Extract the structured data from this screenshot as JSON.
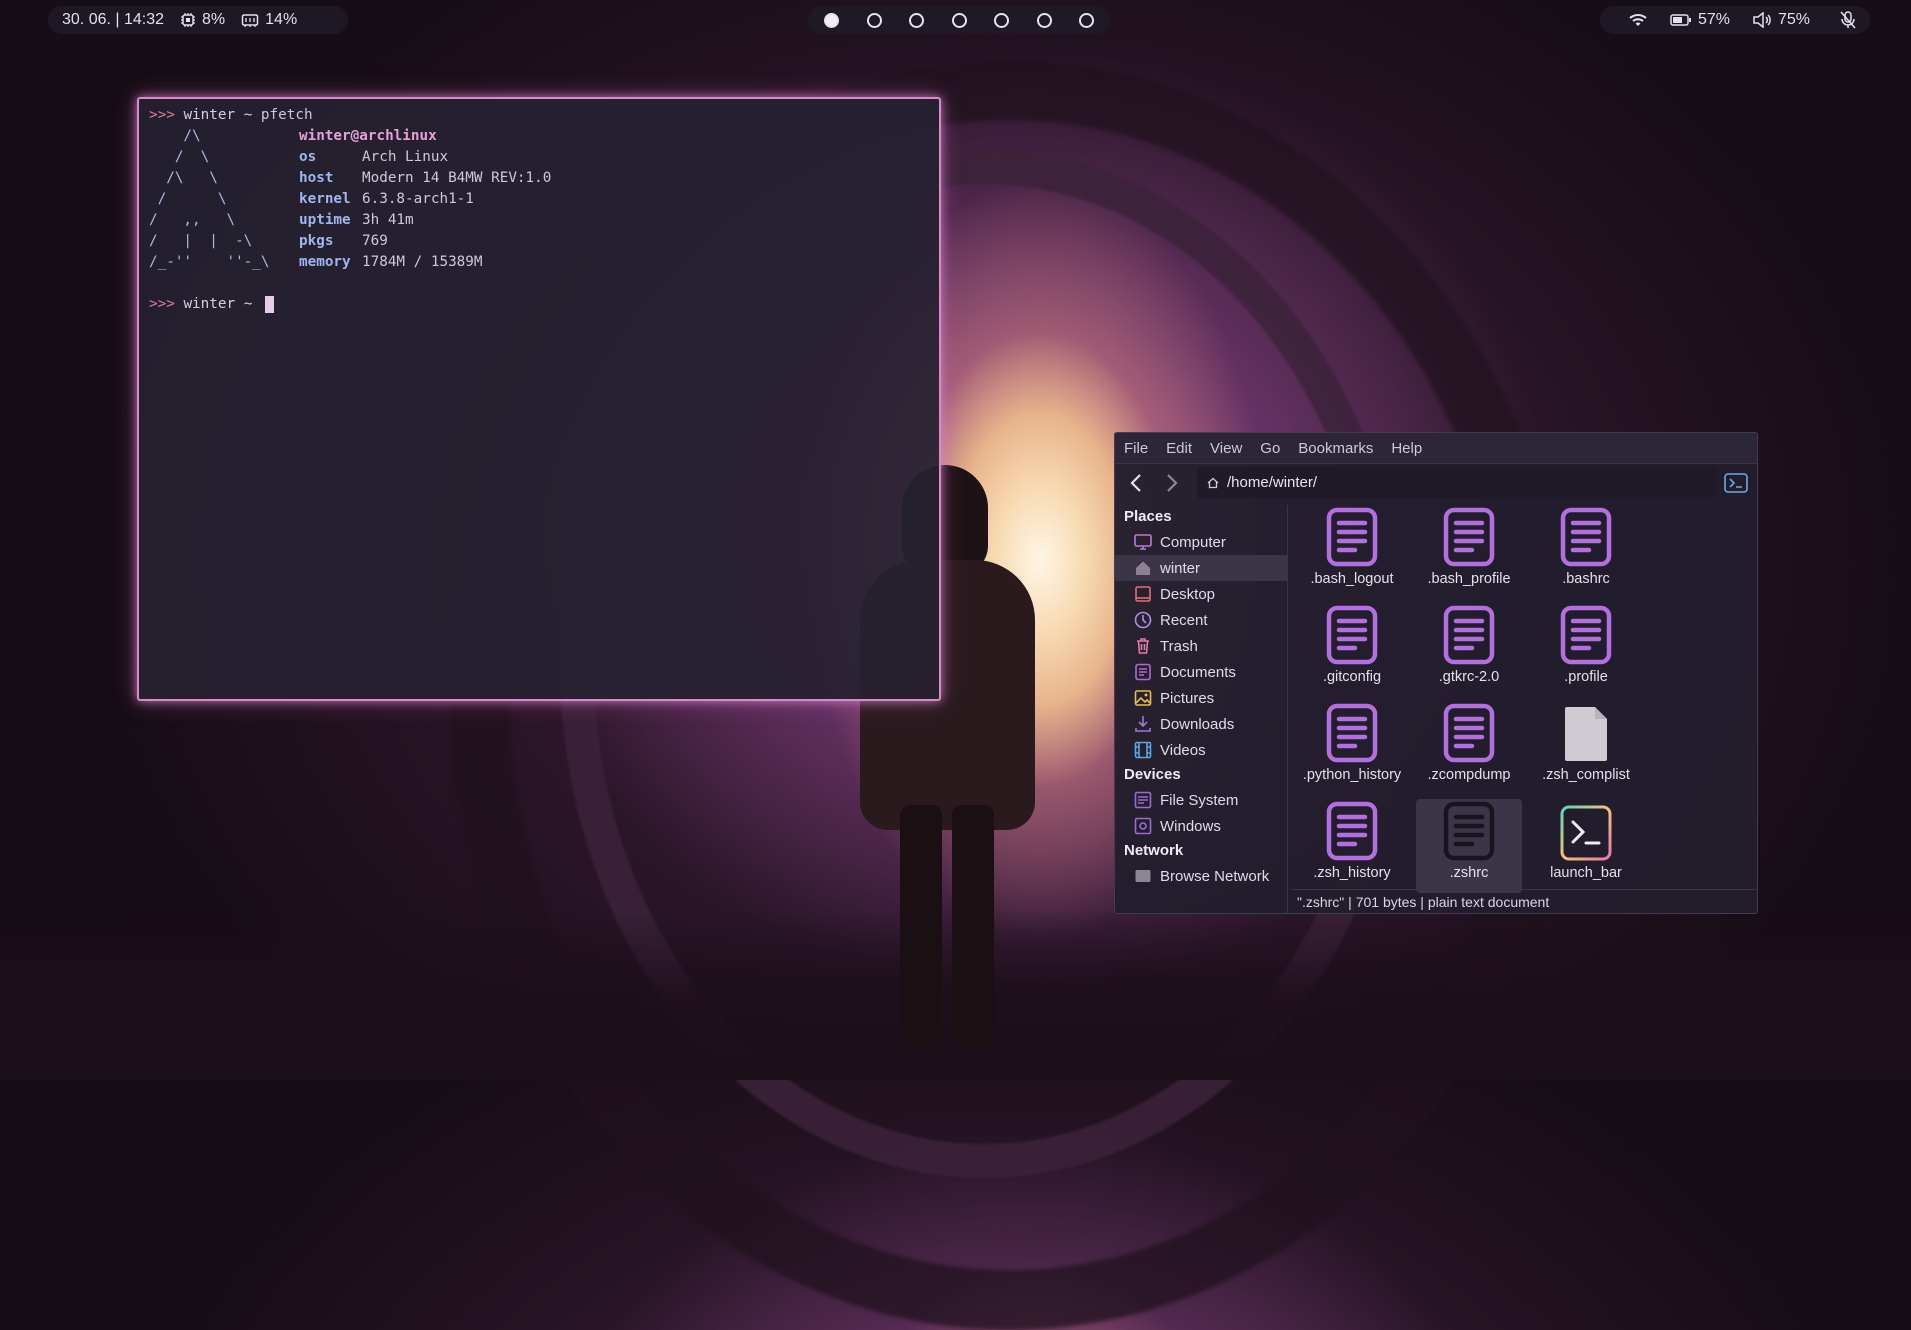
{
  "topbar": {
    "datetime": "30. 06. | 14:32",
    "cpu": "8%",
    "memory": "14%",
    "workspaces": [
      {
        "active": true
      },
      {
        "active": false
      },
      {
        "active": false
      },
      {
        "active": false
      },
      {
        "active": false
      },
      {
        "active": false
      },
      {
        "active": false
      }
    ],
    "battery": "57%",
    "volume": "75%"
  },
  "terminal": {
    "prompt_arrow": ">>>",
    "prompt_user": "winter ~",
    "command": "pfetch",
    "logo_lines": [
      "    /\\",
      "   /  \\",
      "  /\\   \\",
      " /      \\",
      "/   ,,   \\",
      "/   |  |  -\\",
      "/_-''    ''-_\\"
    ],
    "userhost": "winter@archlinux",
    "info": [
      {
        "key": "os",
        "value": "Arch Linux"
      },
      {
        "key": "host",
        "value": "Modern 14 B4MW REV:1.0"
      },
      {
        "key": "kernel",
        "value": "6.3.8-arch1-1"
      },
      {
        "key": "uptime",
        "value": "3h 41m"
      },
      {
        "key": "pkgs",
        "value": "769"
      },
      {
        "key": "memory",
        "value": "1784M / 15389M"
      }
    ]
  },
  "filemanager": {
    "menu": [
      "File",
      "Edit",
      "View",
      "Go",
      "Bookmarks",
      "Help"
    ],
    "path": "/home/winter/",
    "sidebar": {
      "places_label": "Places",
      "places": [
        {
          "label": "Computer",
          "icon": "computer-icon",
          "color": "#b77ad6"
        },
        {
          "label": "winter",
          "icon": "home-icon",
          "color": "#8a8396",
          "selected": true
        },
        {
          "label": "Desktop",
          "icon": "desktop-icon",
          "color": "#e66b7a"
        },
        {
          "label": "Recent",
          "icon": "recent-icon",
          "color": "#b08be0"
        },
        {
          "label": "Trash",
          "icon": "trash-icon",
          "color": "#e07aa6"
        },
        {
          "label": "Documents",
          "icon": "documents-icon",
          "color": "#b266d6"
        },
        {
          "label": "Pictures",
          "icon": "pictures-icon",
          "color": "#e7c04a"
        },
        {
          "label": "Downloads",
          "icon": "downloads-icon",
          "color": "#9c7ad0"
        },
        {
          "label": "Videos",
          "icon": "videos-icon",
          "color": "#5aa8e8"
        }
      ],
      "devices_label": "Devices",
      "devices": [
        {
          "label": "File System",
          "icon": "filesystem-icon",
          "color": "#9d6ad4"
        },
        {
          "label": "Windows",
          "icon": "windows-drive-icon",
          "color": "#9d6ad4"
        }
      ],
      "network_label": "Network",
      "network": [
        {
          "label": "Browse Network",
          "icon": "network-icon",
          "color": "#8c8694"
        }
      ]
    },
    "files": [
      {
        "name": ".bash_logout",
        "type": "text"
      },
      {
        "name": ".bash_profile",
        "type": "text"
      },
      {
        "name": ".bashrc",
        "type": "text"
      },
      {
        "name": ".gitconfig",
        "type": "text"
      },
      {
        "name": ".gtkrc-2.0",
        "type": "text"
      },
      {
        "name": ".profile",
        "type": "text"
      },
      {
        "name": ".python_history",
        "type": "text"
      },
      {
        "name": ".zcompdump",
        "type": "text"
      },
      {
        "name": ".zsh_complist",
        "type": "blank"
      },
      {
        "name": ".zsh_history",
        "type": "text"
      },
      {
        "name": ".zshrc",
        "type": "text-selected",
        "selected": true
      },
      {
        "name": "launch_bar",
        "type": "script"
      }
    ],
    "status": "\".zshrc\" | 701 bytes | plain text document"
  }
}
